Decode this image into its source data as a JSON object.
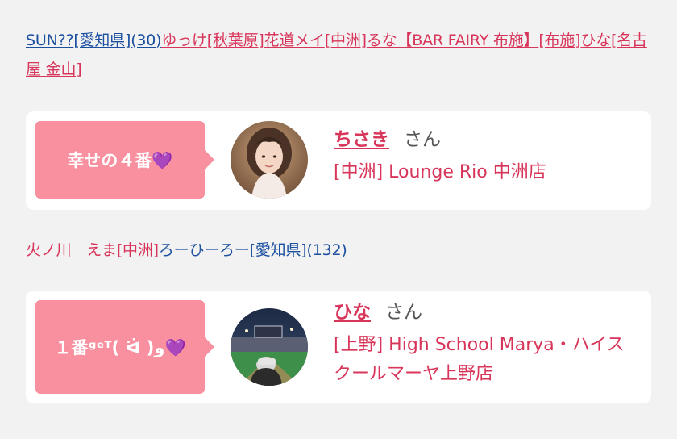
{
  "colors": {
    "accent": "#d8355a",
    "link_blue": "#1a4fa0",
    "tag_bg": "#f8909f",
    "card_bg": "#ffffff",
    "page_bg": "#f2f2f2"
  },
  "line1": [
    {
      "text": "SUN??",
      "color": "blue"
    },
    {
      "text": "[愛知県]",
      "color": "blue"
    },
    {
      "text": "(30)",
      "color": "blue"
    },
    {
      "text": "ゆっけ",
      "color": "pink"
    },
    {
      "text": "[秋葉原]",
      "color": "pink"
    },
    {
      "text": "花道メイ",
      "color": "pink"
    },
    {
      "text": "[中洲]",
      "color": "pink"
    },
    {
      "text": "るな【BAR FAIRY 布施】",
      "color": "pink"
    },
    {
      "text": "[布施]",
      "color": "pink"
    },
    {
      "text": "ひな",
      "color": "pink"
    },
    {
      "text": "[名古屋 金山]",
      "color": "pink"
    }
  ],
  "line2": [
    {
      "text": "火ノ川　えま",
      "color": "pink"
    },
    {
      "text": "[中洲]",
      "color": "pink"
    },
    {
      "text": "ろーひーろー",
      "color": "blue"
    },
    {
      "text": "[愛知県]",
      "color": "blue"
    },
    {
      "text": "(132)",
      "color": "blue"
    }
  ],
  "cards": [
    {
      "tag": "幸せの４番💜",
      "avatar_icon": "woman-portrait-avatar",
      "name": "ちさき",
      "honorific": "さん",
      "shop": "[中洲] Lounge Rio 中洲店"
    },
    {
      "tag": "１番ᵍᵉᵀ( ᐛ )و💜",
      "avatar_icon": "stadium-photo-avatar",
      "name": "ひな",
      "honorific": "さん",
      "shop": "[上野] High School Marya・ハイスクールマーヤ上野店"
    }
  ]
}
